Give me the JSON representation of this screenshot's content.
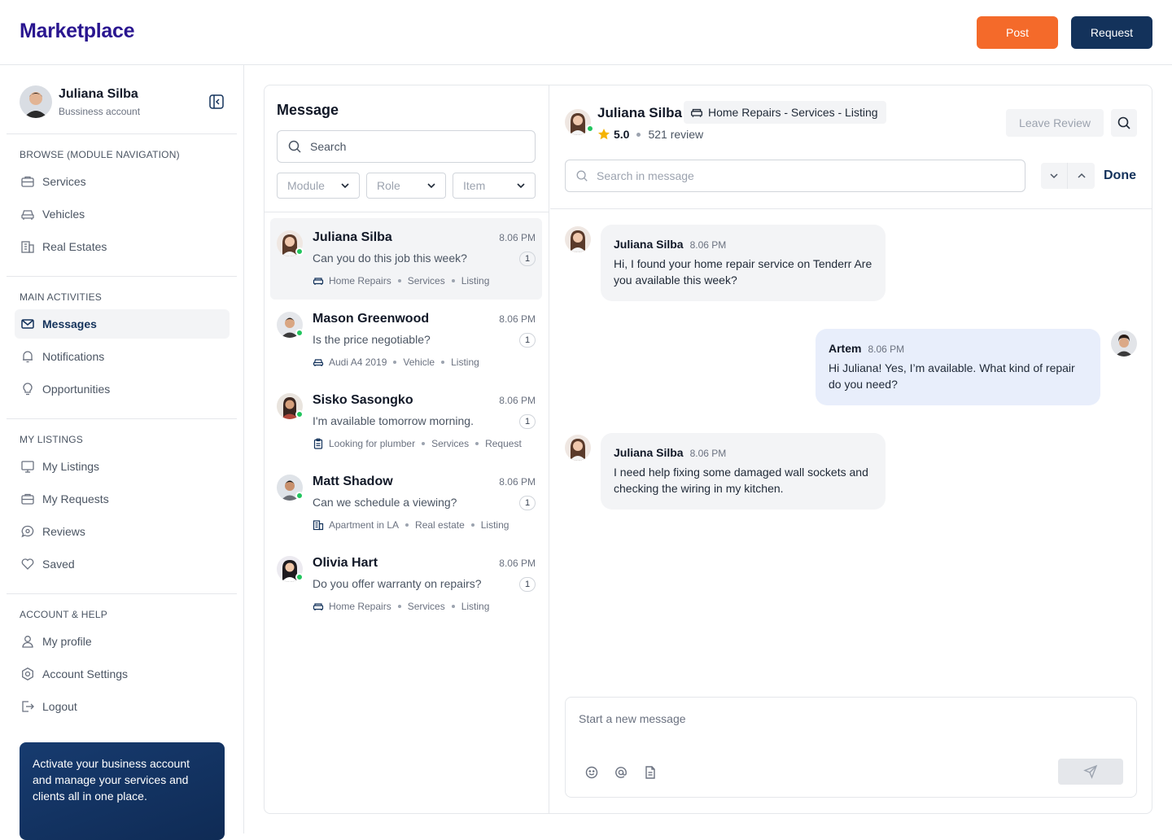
{
  "app": {
    "brand": "Marketplace",
    "post_label": "Post",
    "request_label": "Request"
  },
  "sidebar": {
    "user": {
      "name": "Juliana Silba",
      "account_type": "Bussiness account"
    },
    "sections": [
      {
        "title": "BROWSE (MODULE NAVIGATION)",
        "items": [
          {
            "label": "Services",
            "icon": "briefcase-icon"
          },
          {
            "label": "Vehicles",
            "icon": "car-icon"
          },
          {
            "label": "Real Estates",
            "icon": "building-icon"
          }
        ]
      },
      {
        "title": "MAIN ACTIVITIES",
        "items": [
          {
            "label": "Messages",
            "icon": "mail-icon",
            "active": true
          },
          {
            "label": "Notifications",
            "icon": "bell-icon"
          },
          {
            "label": "Opportunities",
            "icon": "lightbulb-icon"
          }
        ]
      },
      {
        "title": "MY LISTINGS",
        "items": [
          {
            "label": "My Listings",
            "icon": "monitor-icon"
          },
          {
            "label": "My Requests",
            "icon": "briefcase-icon"
          },
          {
            "label": "Reviews",
            "icon": "chat-bubble-icon"
          },
          {
            "label": "Saved",
            "icon": "heart-icon"
          }
        ]
      },
      {
        "title": "ACCOUNT & HELP",
        "items": [
          {
            "label": "My profile",
            "icon": "user-icon"
          },
          {
            "label": "Account Settings",
            "icon": "settings-icon"
          },
          {
            "label": "Logout",
            "icon": "logout-icon"
          }
        ]
      }
    ],
    "promo_text": "Activate your business account and manage your services and clients all in one place."
  },
  "messages_list": {
    "title": "Message",
    "search_placeholder": "Search",
    "filters": [
      "Module",
      "Role",
      "Item"
    ],
    "conversations": [
      {
        "name": "Juliana Silba",
        "time": "8.06 PM",
        "preview": "Can you do this job this week?",
        "unread": "1",
        "meta_icon": "sofa-icon",
        "meta": [
          "Home Repairs",
          "Services",
          "Listing"
        ],
        "active": true
      },
      {
        "name": "Mason Greenwood",
        "time": "8.06 PM",
        "preview": "Is the price negotiable?",
        "unread": "1",
        "meta_icon": "car-icon",
        "meta": [
          "Audi A4 2019",
          "Vehicle",
          "Listing"
        ]
      },
      {
        "name": "Sisko Sasongko",
        "time": "8.06 PM",
        "preview": "I'm available tomorrow morning.",
        "unread": "1",
        "meta_icon": "clipboard-icon",
        "meta": [
          "Looking for plumber",
          "Services",
          "Request"
        ]
      },
      {
        "name": "Matt Shadow",
        "time": "8.06 PM",
        "preview": "Can we schedule a viewing?",
        "unread": "1",
        "meta_icon": "building-icon",
        "meta": [
          "Apartment in LA",
          "Real estate",
          "Listing"
        ]
      },
      {
        "name": "Olivia Hart",
        "time": "8.06 PM",
        "preview": "Do you offer warranty on repairs?",
        "unread": "1",
        "meta_icon": "sofa-icon",
        "meta": [
          "Home Repairs",
          "Services",
          "Listing"
        ]
      }
    ]
  },
  "chat": {
    "contact_name": "Juliana Silba",
    "listing_tag": "Home Repairs - Services - Listing",
    "rating": "5.0",
    "reviews": "521 review",
    "leave_review_label": "Leave Review",
    "search_placeholder": "Search in message",
    "done_label": "Done",
    "messages": [
      {
        "sender": "Juliana Silba",
        "time": "8.06 PM",
        "text": "Hi, I found your home repair service on Tenderr Are you available this week?",
        "direction": "in"
      },
      {
        "sender": "Artem",
        "time": "8.06 PM",
        "text": "Hi Juliana! Yes, I’m available. What kind of repair do you need?",
        "direction": "out"
      },
      {
        "sender": "Juliana Silba",
        "time": "8.06 PM",
        "text": "I need help fixing some damaged wall sockets and checking the wiring in my kitchen.",
        "direction": "in"
      }
    ],
    "composer_placeholder": "Start a new message"
  },
  "colors": {
    "brand": "#2a1690",
    "post": "#f46a2a",
    "primary": "#13325b",
    "online": "#22c55e",
    "star": "#f5b301"
  }
}
